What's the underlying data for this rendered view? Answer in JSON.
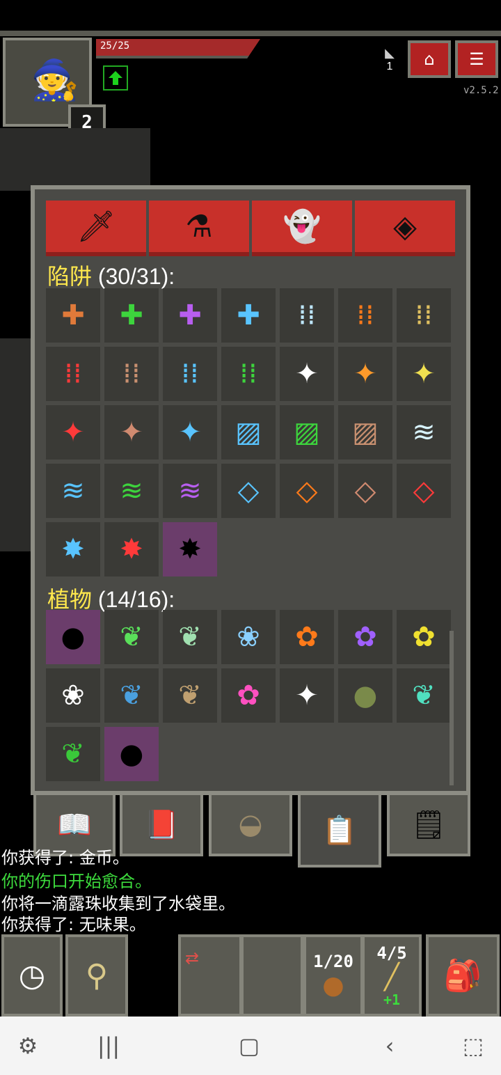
{
  "hud": {
    "hp_text": "25/25",
    "level": "2",
    "depth": "1",
    "version": "v2.5.2",
    "journal_icon": "journal-icon",
    "menu_icon": "menu-icon"
  },
  "tabs": [
    {
      "icon": "sword-icon",
      "glyph": "🗡"
    },
    {
      "icon": "potion-icon",
      "glyph": "⚗"
    },
    {
      "icon": "creature-icon",
      "glyph": "👻"
    },
    {
      "icon": "badge-icon",
      "glyph": "◈"
    }
  ],
  "sections": {
    "traps_label": "陷阱",
    "traps_count": "(30/31):",
    "plants_label": "植物",
    "plants_count": "(14/16):"
  },
  "traps": [
    {
      "g": "✚",
      "c": "#e07a3a"
    },
    {
      "g": "✚",
      "c": "#3dd43d"
    },
    {
      "g": "✚",
      "c": "#b85ef0"
    },
    {
      "g": "✚",
      "c": "#59c4ff"
    },
    {
      "g": "⁞⁞",
      "c": "#bfe8ff"
    },
    {
      "g": "⁞⁞",
      "c": "#ff7a1a"
    },
    {
      "g": "⁞⁞",
      "c": "#e0c060"
    },
    {
      "g": "⁞⁞",
      "c": "#ff3a3a"
    },
    {
      "g": "⁞⁞",
      "c": "#c89070"
    },
    {
      "g": "⁞⁞",
      "c": "#59c4ff"
    },
    {
      "g": "⁞⁞",
      "c": "#3dd43d"
    },
    {
      "g": "✦",
      "c": "#ffffff"
    },
    {
      "g": "✦",
      "c": "#ff9a2a"
    },
    {
      "g": "✦",
      "c": "#f0e050"
    },
    {
      "g": "✦",
      "c": "#ff3a3a"
    },
    {
      "g": "✦",
      "c": "#d08a70"
    },
    {
      "g": "✦",
      "c": "#59c4ff"
    },
    {
      "g": "▨",
      "c": "#59c4ff"
    },
    {
      "g": "▨",
      "c": "#3dd43d"
    },
    {
      "g": "▨",
      "c": "#c89070"
    },
    {
      "g": "≋",
      "c": "#d8f4ff"
    },
    {
      "g": "≋",
      "c": "#59c4ff"
    },
    {
      "g": "≋",
      "c": "#3dd43d"
    },
    {
      "g": "≋",
      "c": "#b85ef0"
    },
    {
      "g": "◇",
      "c": "#59c4ff"
    },
    {
      "g": "◇",
      "c": "#ff7a1a"
    },
    {
      "g": "◇",
      "c": "#d08a70"
    },
    {
      "g": "◇",
      "c": "#ff3a3a"
    },
    {
      "g": "✸",
      "c": "#59c4ff"
    },
    {
      "g": "✸",
      "c": "#ff3a3a"
    },
    {
      "g": "✸",
      "c": "#000000",
      "hl": true
    }
  ],
  "plants": [
    {
      "g": "●",
      "c": "#000000",
      "hl": true
    },
    {
      "g": "❦",
      "c": "#5ae05a"
    },
    {
      "g": "❦",
      "c": "#a0e0b0"
    },
    {
      "g": "❀",
      "c": "#8ad0ff"
    },
    {
      "g": "✿",
      "c": "#ff7a1a"
    },
    {
      "g": "✿",
      "c": "#a060ff"
    },
    {
      "g": "✿",
      "c": "#f0e030"
    },
    {
      "g": "❀",
      "c": "#ffffff"
    },
    {
      "g": "❦",
      "c": "#4aa0e0"
    },
    {
      "g": "❦",
      "c": "#c0a070"
    },
    {
      "g": "✿",
      "c": "#ff50c0"
    },
    {
      "g": "✦",
      "c": "#ffffff"
    },
    {
      "g": "●",
      "c": "#7a8a4a"
    },
    {
      "g": "❦",
      "c": "#50e0c0"
    },
    {
      "g": "❦",
      "c": "#3ac83a"
    },
    {
      "g": "●",
      "c": "#000000",
      "hl": true
    }
  ],
  "bottom_tabs": [
    {
      "icon": "open-book-icon",
      "glyph": "📖"
    },
    {
      "icon": "red-book-icon",
      "glyph": "📕"
    },
    {
      "icon": "bowl-icon",
      "glyph": "◒"
    },
    {
      "icon": "clipboard-icon",
      "glyph": "📋"
    },
    {
      "icon": "scroll-icon",
      "glyph": "🗒"
    }
  ],
  "log": [
    {
      "text": "你获得了: 金币。",
      "color": "#ffffff"
    },
    {
      "text": "你的伤口开始愈合。",
      "color": "#3ddb3d"
    },
    {
      "text": "你将一滴露珠收集到了水袋里。",
      "color": "#ffffff"
    },
    {
      "text": "你获得了: 无味果。",
      "color": "#ffffff"
    }
  ],
  "toolbar": {
    "waterskin_count": "1/20",
    "wand_count": "4/5",
    "wand_bonus": "+1"
  }
}
